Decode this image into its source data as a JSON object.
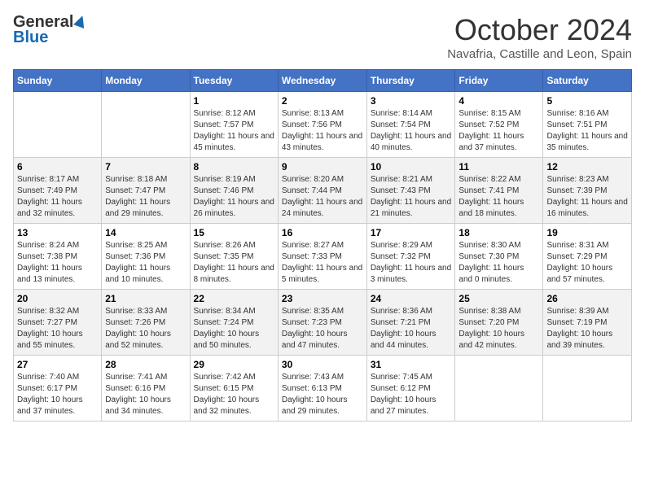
{
  "logo": {
    "general": "General",
    "blue": "Blue"
  },
  "title": "October 2024",
  "location": "Navafria, Castille and Leon, Spain",
  "weekdays": [
    "Sunday",
    "Monday",
    "Tuesday",
    "Wednesday",
    "Thursday",
    "Friday",
    "Saturday"
  ],
  "weeks": [
    [
      {
        "day": "",
        "info": ""
      },
      {
        "day": "",
        "info": ""
      },
      {
        "day": "1",
        "info": "Sunrise: 8:12 AM\nSunset: 7:57 PM\nDaylight: 11 hours and 45 minutes."
      },
      {
        "day": "2",
        "info": "Sunrise: 8:13 AM\nSunset: 7:56 PM\nDaylight: 11 hours and 43 minutes."
      },
      {
        "day": "3",
        "info": "Sunrise: 8:14 AM\nSunset: 7:54 PM\nDaylight: 11 hours and 40 minutes."
      },
      {
        "day": "4",
        "info": "Sunrise: 8:15 AM\nSunset: 7:52 PM\nDaylight: 11 hours and 37 minutes."
      },
      {
        "day": "5",
        "info": "Sunrise: 8:16 AM\nSunset: 7:51 PM\nDaylight: 11 hours and 35 minutes."
      }
    ],
    [
      {
        "day": "6",
        "info": "Sunrise: 8:17 AM\nSunset: 7:49 PM\nDaylight: 11 hours and 32 minutes."
      },
      {
        "day": "7",
        "info": "Sunrise: 8:18 AM\nSunset: 7:47 PM\nDaylight: 11 hours and 29 minutes."
      },
      {
        "day": "8",
        "info": "Sunrise: 8:19 AM\nSunset: 7:46 PM\nDaylight: 11 hours and 26 minutes."
      },
      {
        "day": "9",
        "info": "Sunrise: 8:20 AM\nSunset: 7:44 PM\nDaylight: 11 hours and 24 minutes."
      },
      {
        "day": "10",
        "info": "Sunrise: 8:21 AM\nSunset: 7:43 PM\nDaylight: 11 hours and 21 minutes."
      },
      {
        "day": "11",
        "info": "Sunrise: 8:22 AM\nSunset: 7:41 PM\nDaylight: 11 hours and 18 minutes."
      },
      {
        "day": "12",
        "info": "Sunrise: 8:23 AM\nSunset: 7:39 PM\nDaylight: 11 hours and 16 minutes."
      }
    ],
    [
      {
        "day": "13",
        "info": "Sunrise: 8:24 AM\nSunset: 7:38 PM\nDaylight: 11 hours and 13 minutes."
      },
      {
        "day": "14",
        "info": "Sunrise: 8:25 AM\nSunset: 7:36 PM\nDaylight: 11 hours and 10 minutes."
      },
      {
        "day": "15",
        "info": "Sunrise: 8:26 AM\nSunset: 7:35 PM\nDaylight: 11 hours and 8 minutes."
      },
      {
        "day": "16",
        "info": "Sunrise: 8:27 AM\nSunset: 7:33 PM\nDaylight: 11 hours and 5 minutes."
      },
      {
        "day": "17",
        "info": "Sunrise: 8:29 AM\nSunset: 7:32 PM\nDaylight: 11 hours and 3 minutes."
      },
      {
        "day": "18",
        "info": "Sunrise: 8:30 AM\nSunset: 7:30 PM\nDaylight: 11 hours and 0 minutes."
      },
      {
        "day": "19",
        "info": "Sunrise: 8:31 AM\nSunset: 7:29 PM\nDaylight: 10 hours and 57 minutes."
      }
    ],
    [
      {
        "day": "20",
        "info": "Sunrise: 8:32 AM\nSunset: 7:27 PM\nDaylight: 10 hours and 55 minutes."
      },
      {
        "day": "21",
        "info": "Sunrise: 8:33 AM\nSunset: 7:26 PM\nDaylight: 10 hours and 52 minutes."
      },
      {
        "day": "22",
        "info": "Sunrise: 8:34 AM\nSunset: 7:24 PM\nDaylight: 10 hours and 50 minutes."
      },
      {
        "day": "23",
        "info": "Sunrise: 8:35 AM\nSunset: 7:23 PM\nDaylight: 10 hours and 47 minutes."
      },
      {
        "day": "24",
        "info": "Sunrise: 8:36 AM\nSunset: 7:21 PM\nDaylight: 10 hours and 44 minutes."
      },
      {
        "day": "25",
        "info": "Sunrise: 8:38 AM\nSunset: 7:20 PM\nDaylight: 10 hours and 42 minutes."
      },
      {
        "day": "26",
        "info": "Sunrise: 8:39 AM\nSunset: 7:19 PM\nDaylight: 10 hours and 39 minutes."
      }
    ],
    [
      {
        "day": "27",
        "info": "Sunrise: 7:40 AM\nSunset: 6:17 PM\nDaylight: 10 hours and 37 minutes."
      },
      {
        "day": "28",
        "info": "Sunrise: 7:41 AM\nSunset: 6:16 PM\nDaylight: 10 hours and 34 minutes."
      },
      {
        "day": "29",
        "info": "Sunrise: 7:42 AM\nSunset: 6:15 PM\nDaylight: 10 hours and 32 minutes."
      },
      {
        "day": "30",
        "info": "Sunrise: 7:43 AM\nSunset: 6:13 PM\nDaylight: 10 hours and 29 minutes."
      },
      {
        "day": "31",
        "info": "Sunrise: 7:45 AM\nSunset: 6:12 PM\nDaylight: 10 hours and 27 minutes."
      },
      {
        "day": "",
        "info": ""
      },
      {
        "day": "",
        "info": ""
      }
    ]
  ]
}
